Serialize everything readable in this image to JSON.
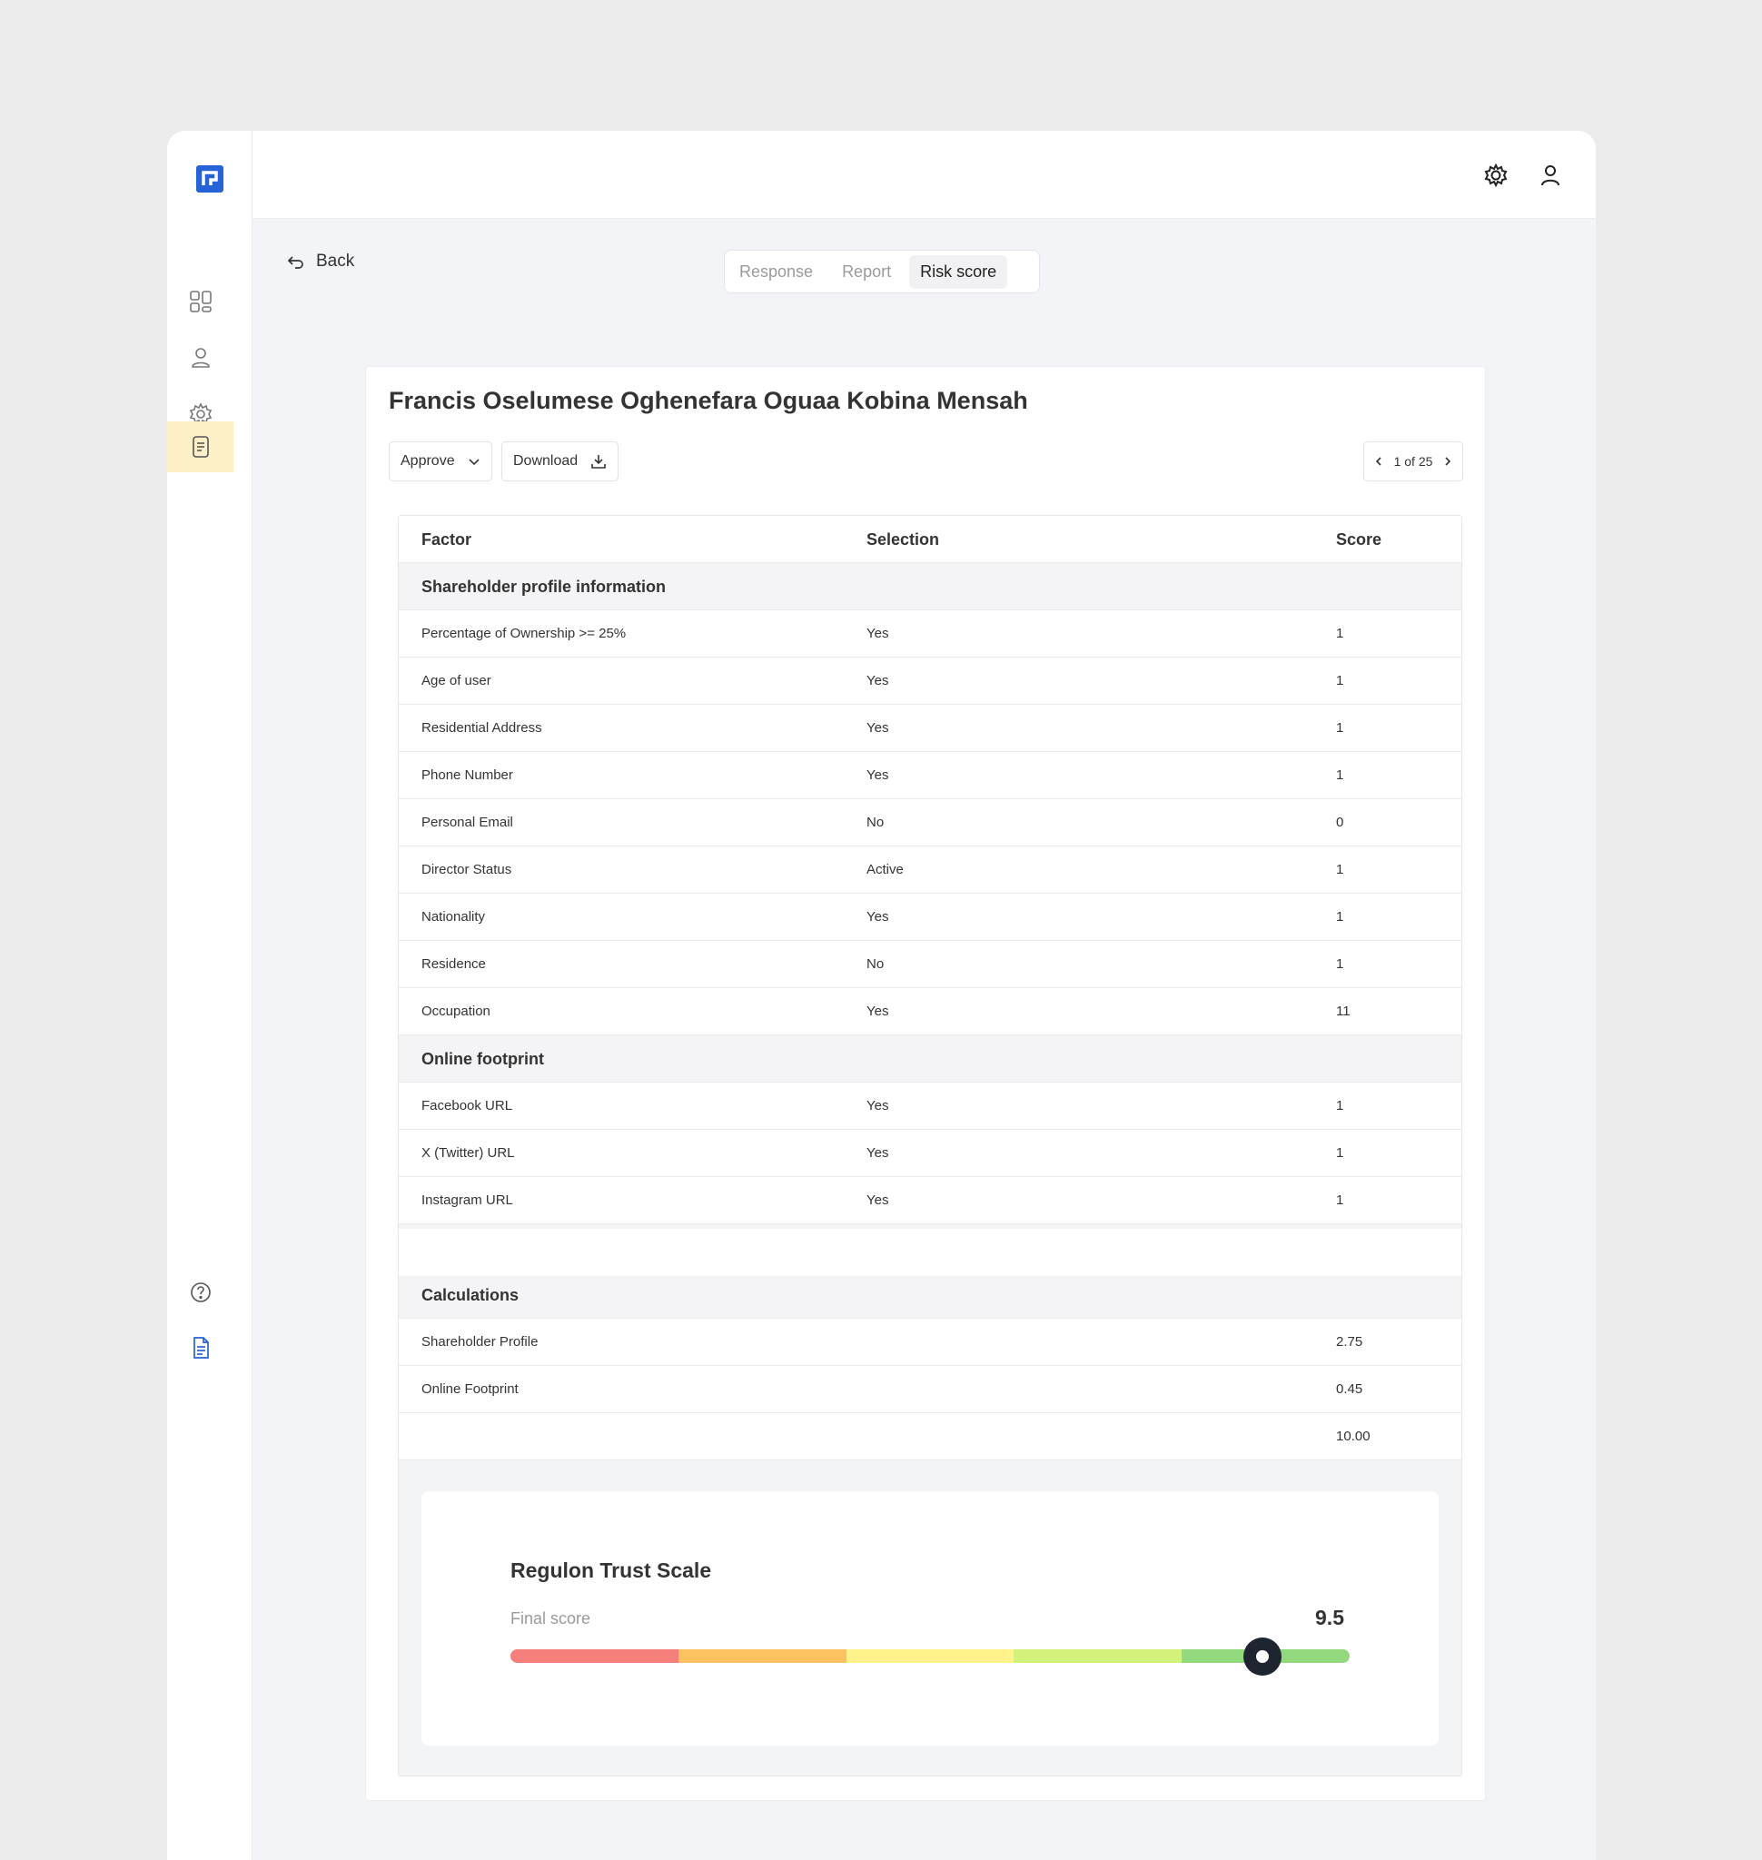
{
  "sidebar": {
    "icons": [
      "logo-icon",
      "dashboard-icon",
      "user-icon",
      "settings-cog-icon",
      "document-icon",
      "help-icon",
      "file-icon"
    ]
  },
  "topbar": {
    "icons": [
      "gear-icon",
      "user-icon"
    ]
  },
  "nav": {
    "back_label": "Back",
    "tabs": [
      {
        "label": "Response"
      },
      {
        "label": "Report"
      },
      {
        "label": "Risk score"
      }
    ],
    "active_tab": "Risk score"
  },
  "card": {
    "title": "Francis Oselumese Oghenefara Oguaa Kobina Mensah",
    "approve_label": "Approve",
    "download_label": "Download",
    "pager_text": "1 of 25"
  },
  "table": {
    "headers": [
      "Factor",
      "Selection",
      "Score"
    ],
    "sections": [
      {
        "title": "Shareholder profile information",
        "rows": [
          {
            "factor": "Percentage of Ownership >= 25%",
            "selection": "Yes",
            "score": "1"
          },
          {
            "factor": "Age of user",
            "selection": "Yes",
            "score": "1"
          },
          {
            "factor": "Residential Address",
            "selection": "Yes",
            "score": "1"
          },
          {
            "factor": "Phone Number",
            "selection": "Yes",
            "score": "1"
          },
          {
            "factor": "Personal Email",
            "selection": "No",
            "score": "0"
          },
          {
            "factor": "Director Status",
            "selection": "Active",
            "score": "1"
          },
          {
            "factor": "Nationality",
            "selection": "Yes",
            "score": "1"
          },
          {
            "factor": "Residence",
            "selection": "No",
            "score": "1"
          },
          {
            "factor": "Occupation",
            "selection": "Yes",
            "score": "11"
          }
        ]
      },
      {
        "title": "Online footprint",
        "rows": [
          {
            "factor": "Facebook URL",
            "selection": "Yes",
            "score": "1"
          },
          {
            "factor": "X (Twitter) URL",
            "selection": "Yes",
            "score": "1"
          },
          {
            "factor": "Instagram URL",
            "selection": "Yes",
            "score": "1"
          }
        ]
      }
    ],
    "calculations": {
      "title": "Calculations",
      "rows": [
        {
          "factor": "Shareholder Profile",
          "score": "2.75"
        },
        {
          "factor": "Online Footprint",
          "score": "0.45"
        },
        {
          "factor": "",
          "score": "10.00"
        }
      ]
    }
  },
  "trust_scale": {
    "title": "Regulon Trust Scale",
    "label": "Final score",
    "value": "9.5",
    "scale_min": 0,
    "scale_max": 10.6,
    "score_numeric": 9.5,
    "colors": [
      "#f47f7b",
      "#fcc262",
      "#fdf38a",
      "#d3f27c",
      "#92d97d"
    ]
  }
}
